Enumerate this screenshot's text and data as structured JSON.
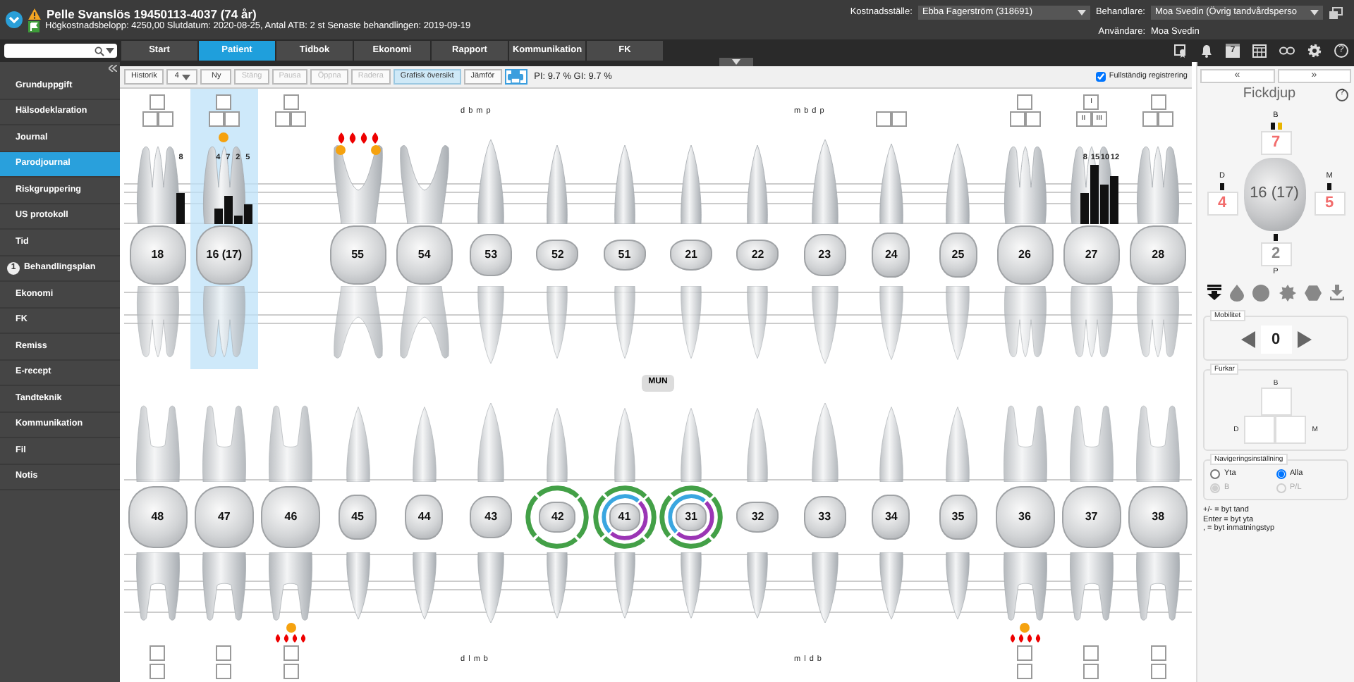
{
  "header": {
    "patient": "Pelle Svanslös 19450113-4037 (74 år)",
    "info": "Högkostnadsbelopp: 4250,00 Slutdatum: 2020-08-25, Antal ATB: 2 st Senaste behandlingen: 2019-09-19",
    "fields": [
      {
        "label": "Kostnadsställe:",
        "value": "Ebba Fagerström (318691)",
        "kind": "dropdown"
      },
      {
        "label": "Behandlare:",
        "value": "Moa Svedin (Övrig tandvårdsperso",
        "kind": "dropdown"
      },
      {
        "label": "Användare:",
        "value": "Moa Svedin",
        "kind": "text"
      }
    ]
  },
  "tabs": [
    {
      "label": "Start",
      "selected": false
    },
    {
      "label": "Patient",
      "selected": true
    },
    {
      "label": "Tidbok",
      "selected": false
    },
    {
      "label": "Ekonomi",
      "selected": false
    },
    {
      "label": "Rapport",
      "selected": false
    },
    {
      "label": "Kommunikation",
      "selected": false
    },
    {
      "label": "FK",
      "selected": false
    }
  ],
  "nav_icons": {
    "calendar_day": "7",
    "help": "?"
  },
  "sidebar": {
    "items": [
      {
        "label": "Grunduppgift",
        "selected": false
      },
      {
        "label": "Hälsodeklaration",
        "selected": false
      },
      {
        "label": "Journal",
        "selected": false
      },
      {
        "label": "Parodjournal",
        "selected": true
      },
      {
        "label": "Riskgruppering",
        "selected": false
      },
      {
        "label": "US protokoll",
        "selected": false
      },
      {
        "label": "Tid",
        "selected": false
      },
      {
        "label": "Behandlingsplan",
        "selected": false,
        "badge": "1"
      },
      {
        "label": "Ekonomi",
        "selected": false
      },
      {
        "label": "FK",
        "selected": false
      },
      {
        "label": "Remiss",
        "selected": false
      },
      {
        "label": "E-recept",
        "selected": false
      },
      {
        "label": "Tandteknik",
        "selected": false
      },
      {
        "label": "Kommunikation",
        "selected": false
      },
      {
        "label": "Fil",
        "selected": false
      },
      {
        "label": "Notis",
        "selected": false
      }
    ]
  },
  "toolbar": {
    "buttons": [
      {
        "label": "Historik",
        "kind": "button",
        "disabled": false,
        "selected": false
      },
      {
        "label": "4",
        "kind": "dropdown",
        "disabled": false,
        "selected": false
      },
      {
        "label": "Ny",
        "kind": "button",
        "disabled": false,
        "selected": false
      },
      {
        "label": "Stäng",
        "kind": "button",
        "disabled": true,
        "selected": false
      },
      {
        "label": "Pausa",
        "kind": "button",
        "disabled": true,
        "selected": false
      },
      {
        "label": "Öppna",
        "kind": "button",
        "disabled": true,
        "selected": false
      },
      {
        "label": "Radera",
        "kind": "button",
        "disabled": true,
        "selected": false
      },
      {
        "label": "Grafisk översikt",
        "kind": "button",
        "disabled": false,
        "selected": true
      },
      {
        "label": "Jämför",
        "kind": "button",
        "disabled": false,
        "selected": false
      },
      {
        "kind": "print"
      }
    ],
    "stats": "PI: 9.7 % GI: 9.7 %",
    "full_registration": {
      "label": "Fullständig registrering",
      "checked": true
    }
  },
  "chart": {
    "center_button": "MUN",
    "upper": [
      {
        "number": "18",
        "kind": "molar",
        "selected": false,
        "furcation": {
          "kind": "triple"
        },
        "pockets": [
          {
            "depth": "8"
          }
        ]
      },
      {
        "number": "16 (17)",
        "kind": "molar",
        "selected": true,
        "furcation": {
          "kind": "triple"
        },
        "plaque": {
          "kind": "single"
        },
        "pockets": [
          {
            "depth": "4"
          },
          {
            "depth": "7"
          },
          {
            "depth": "2"
          },
          {
            "depth": "5"
          }
        ]
      },
      {
        "kind": "missing",
        "selected": false,
        "furcation": {
          "kind": "triple"
        }
      },
      {
        "number": "55",
        "kind": "deciduous",
        "selected": false,
        "plaque": {
          "kind": "pair"
        },
        "bleeding": true
      },
      {
        "number": "54",
        "kind": "deciduous",
        "selected": false
      },
      {
        "number": "53",
        "kind": "canine",
        "selected": false,
        "surface_label": "d b m p"
      },
      {
        "number": "52",
        "kind": "incisor",
        "selected": false
      },
      {
        "number": "51",
        "kind": "incisor",
        "selected": false
      },
      {
        "number": "21",
        "kind": "incisor",
        "selected": false
      },
      {
        "number": "22",
        "kind": "incisor",
        "selected": false
      },
      {
        "number": "23",
        "kind": "canine",
        "selected": false,
        "surface_label": "m b d p"
      },
      {
        "number": "24",
        "kind": "premolar",
        "selected": false,
        "furcation": {
          "kind": "pair"
        }
      },
      {
        "number": "25",
        "kind": "premolar",
        "selected": false
      },
      {
        "number": "26",
        "kind": "molar",
        "selected": false,
        "furcation": {
          "kind": "triple"
        }
      },
      {
        "number": "27",
        "kind": "molar",
        "selected": false,
        "furcation": {
          "kind": "triple",
          "labels": [
            "I",
            "II",
            "III"
          ]
        },
        "pockets": [
          {
            "depth": "8"
          },
          {
            "depth": "15"
          },
          {
            "depth": "10"
          },
          {
            "depth": "12"
          }
        ]
      },
      {
        "number": "28",
        "kind": "molar",
        "selected": false,
        "furcation": {
          "kind": "triple"
        }
      }
    ],
    "lower": [
      {
        "number": "48",
        "kind": "molar",
        "selected": false,
        "furcation": {
          "kind": "stacked"
        }
      },
      {
        "number": "47",
        "kind": "molar",
        "selected": false,
        "furcation": {
          "kind": "stacked"
        }
      },
      {
        "number": "46",
        "kind": "molar",
        "selected": false,
        "furcation": {
          "kind": "stacked"
        },
        "plaque": {
          "kind": "single"
        },
        "bleeding": true
      },
      {
        "number": "45",
        "kind": "premolar",
        "selected": false
      },
      {
        "number": "44",
        "kind": "premolar",
        "selected": false
      },
      {
        "number": "43",
        "kind": "canine",
        "selected": false,
        "surface_label": "d l m b"
      },
      {
        "number": "42",
        "kind": "incisor",
        "selected": false,
        "rings": [
          {
            "kind": "outer",
            "color": "#43a047"
          }
        ]
      },
      {
        "number": "41",
        "kind": "incisor",
        "selected": false,
        "rings": [
          {
            "kind": "outer",
            "color": "#43a047"
          },
          {
            "kind": "inner-left",
            "color": "#3aa6e0"
          },
          {
            "kind": "inner-right",
            "color": "#9b35b5"
          }
        ]
      },
      {
        "number": "31",
        "kind": "incisor",
        "selected": false,
        "rings": [
          {
            "kind": "outer",
            "color": "#43a047"
          },
          {
            "kind": "inner-left",
            "color": "#3aa6e0"
          },
          {
            "kind": "inner-right",
            "color": "#9b35b5"
          }
        ]
      },
      {
        "number": "32",
        "kind": "incisor",
        "selected": false
      },
      {
        "number": "33",
        "kind": "canine",
        "selected": false,
        "surface_label": "m l d b"
      },
      {
        "number": "34",
        "kind": "premolar",
        "selected": false
      },
      {
        "number": "35",
        "kind": "premolar",
        "selected": false
      },
      {
        "number": "36",
        "kind": "molar",
        "selected": false,
        "furcation": {
          "kind": "stacked"
        },
        "plaque": {
          "kind": "single"
        },
        "bleeding": true
      },
      {
        "number": "37",
        "kind": "molar",
        "selected": false,
        "furcation": {
          "kind": "stacked"
        }
      },
      {
        "number": "38",
        "kind": "molar",
        "selected": false,
        "furcation": {
          "kind": "stacked"
        }
      }
    ]
  },
  "panel": {
    "nav_buttons": [
      "«",
      "»"
    ],
    "title": "Fickdjup",
    "help": "?",
    "tooth": "16 (17)",
    "sites": [
      {
        "label": "B",
        "value": "7",
        "color": "#f26d6d",
        "plaque": true
      },
      {
        "label": "D",
        "value": "4",
        "color": "#f26d6d"
      },
      {
        "label": "M",
        "value": "5",
        "color": "#f26d6d"
      },
      {
        "label": "P",
        "value": "2",
        "color": "#8a8a8a"
      }
    ],
    "mobility": {
      "title": "Mobilitet",
      "value": "0"
    },
    "furcation": {
      "title": "Furkar",
      "labels": [
        "B",
        "D",
        "M"
      ]
    },
    "navigation": {
      "title": "Navigeringsinställning",
      "options": [
        {
          "label": "Yta",
          "checked": false,
          "disabled": false
        },
        {
          "label": "Alla",
          "checked": true,
          "disabled": false
        },
        {
          "label": "B",
          "checked": true,
          "disabled": true
        },
        {
          "label": "P/L",
          "checked": false,
          "disabled": true
        }
      ]
    },
    "hints": [
      "+/- = byt tand",
      "Enter = byt yta",
      ", = byt inmatningstyp"
    ]
  }
}
